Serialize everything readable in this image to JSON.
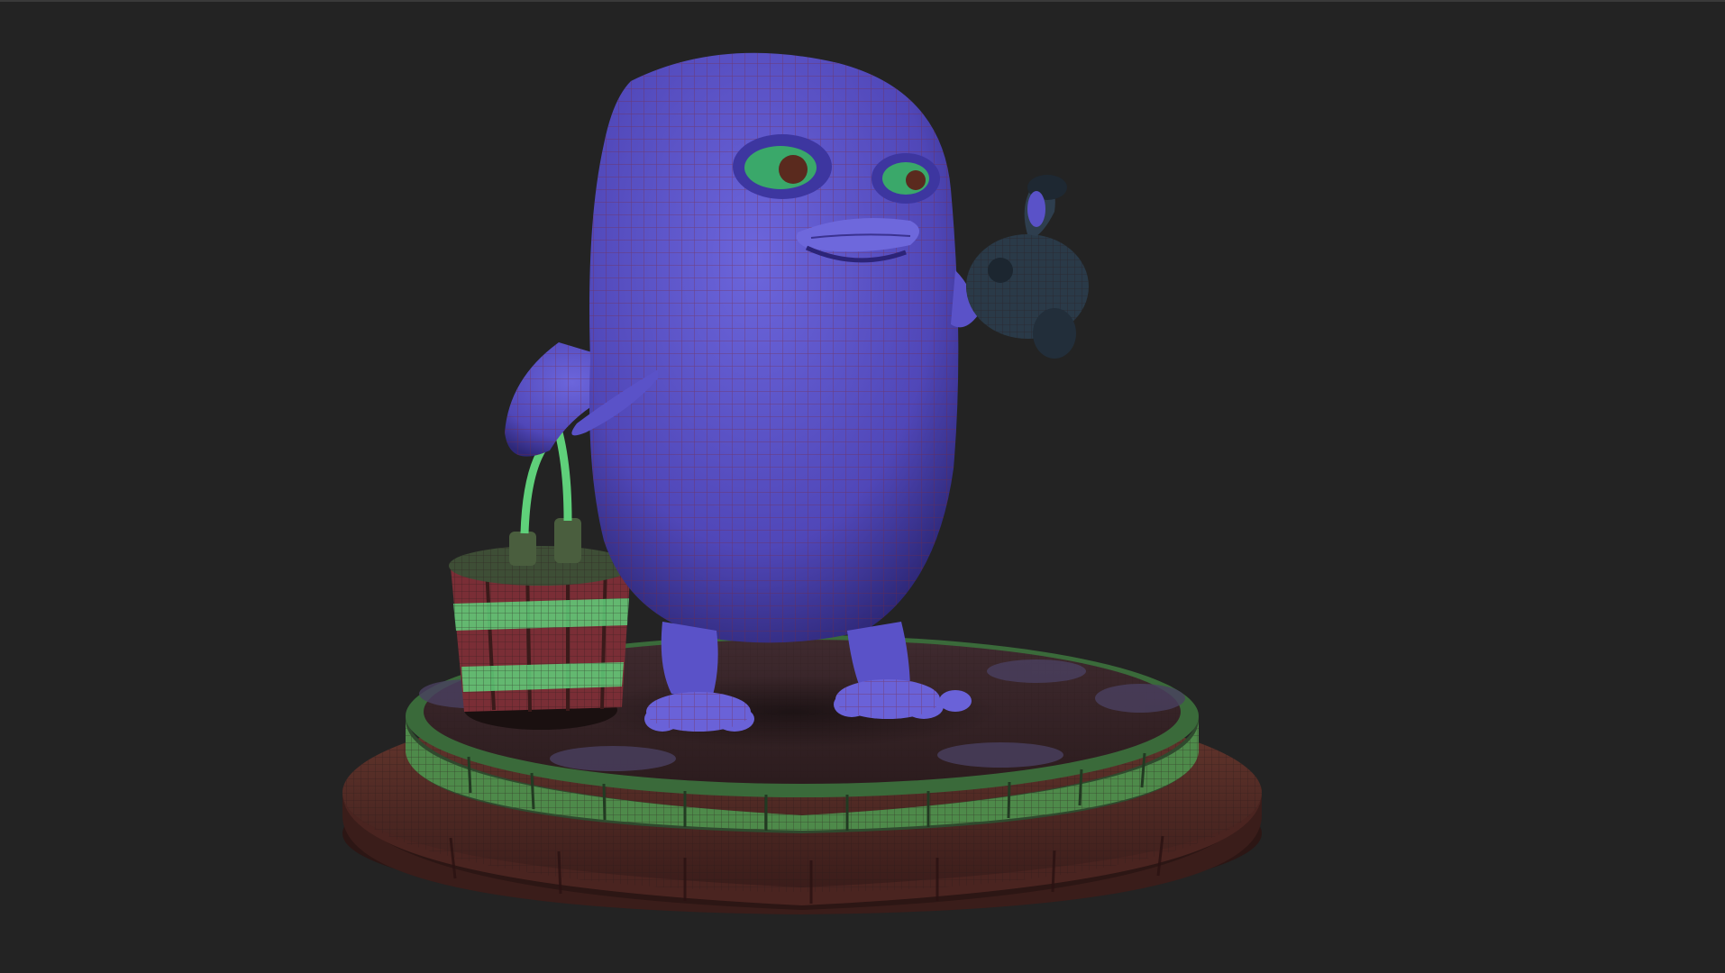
{
  "viewport": {
    "background": "#232323"
  },
  "model": {
    "character_color": "#5b55c8",
    "wire_color": "#7a2a3a",
    "accent_green": "#4fae5c",
    "base_brown": "#5a2e2a"
  }
}
